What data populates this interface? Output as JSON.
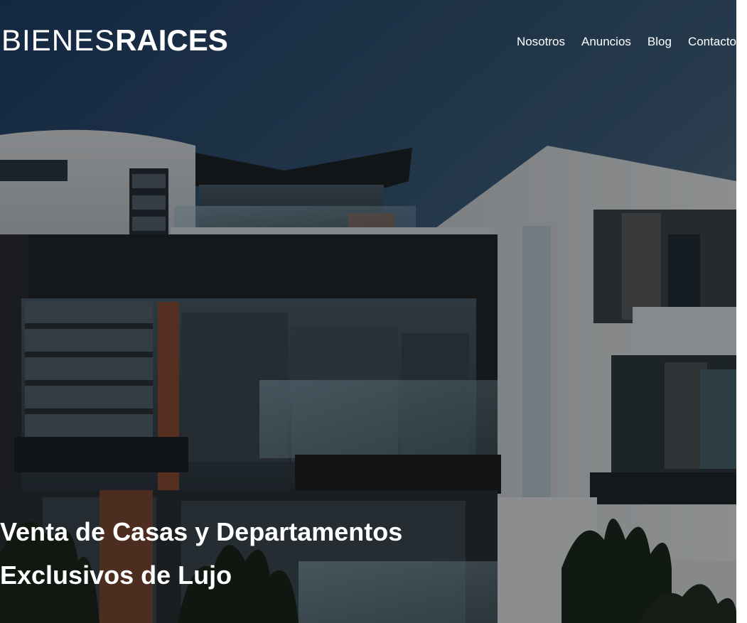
{
  "brand": {
    "logo_light": "BIENES",
    "logo_bold": "RAICES"
  },
  "nav": {
    "items": [
      "Nosotros",
      "Anuncios",
      "Blog",
      "Contacto"
    ]
  },
  "hero": {
    "title_line1": "Venta de Casas y Departamentos",
    "title_line2": "Exclusivos de Lujo",
    "image": "modern-house-photo"
  },
  "colors": {
    "overlay": "#000000",
    "text": "#ffffff"
  }
}
